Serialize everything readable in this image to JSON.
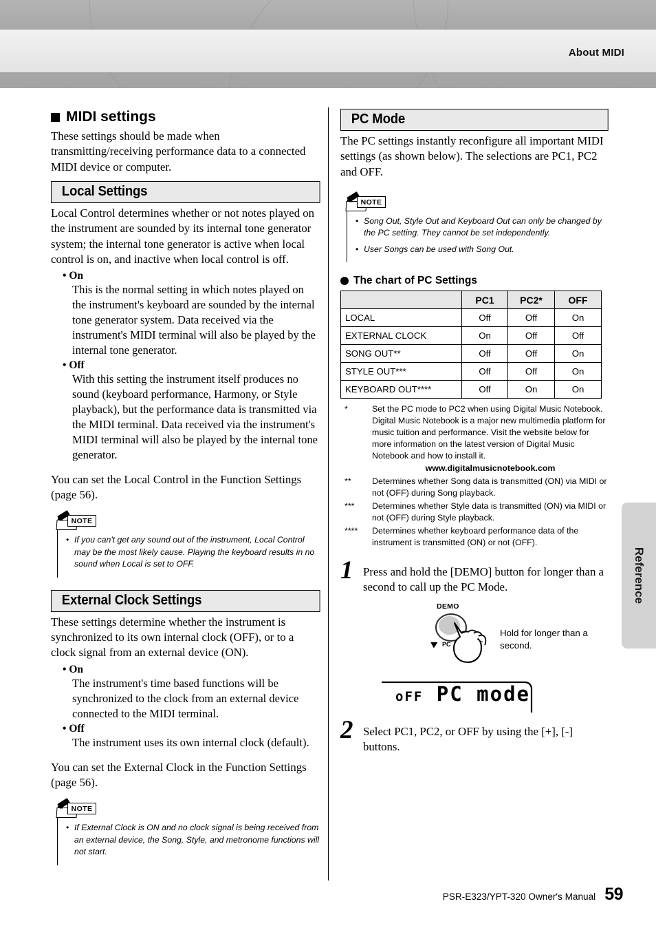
{
  "header": {
    "title": "About MIDI"
  },
  "side_tab": {
    "label": "Reference"
  },
  "footer": {
    "manual": "PSR-E323/YPT-320   Owner's Manual",
    "page": "59"
  },
  "left_column": {
    "heading": "MIDI settings",
    "intro": "These settings should be made when transmitting/receiving performance data to a connected MIDI device or computer.",
    "local": {
      "bar_title": "Local Settings",
      "intro": "Local Control determines whether or not notes played on the instrument are sounded by its internal tone generator system; the internal tone generator is active when local control is on, and inactive when local control is off.",
      "on_label": "On",
      "on_text": "This is the normal setting in which notes played on the instrument's keyboard are sounded by the internal tone generator system. Data received via the instrument's MIDI terminal will also be played by the internal tone generator.",
      "off_label": "Off",
      "off_text": "With this setting the instrument itself produces no sound (keyboard performance, Harmony, or Style playback), but the performance data is transmitted via the MIDI terminal. Data received via the instrument's MIDI terminal will also be played by the internal tone generator.",
      "closing": "You can set the Local Control in the Function Settings (page 56).",
      "note_badge": "NOTE",
      "note_text": "If you can't get any sound out of the instrument, Local Control may be the most likely cause. Playing the keyboard results in no sound when Local is set to OFF."
    },
    "external_clock": {
      "bar_title": "External Clock Settings",
      "intro": "These settings determine whether the instrument is synchronized to its own internal clock (OFF), or to a clock signal from an external device (ON).",
      "on_label": "On",
      "on_text": "The instrument's time based functions will be synchronized to the clock from an external device connected to the MIDI terminal.",
      "off_label": "Off",
      "off_text": "The instrument uses its own internal clock (default).",
      "closing": "You can set the External Clock in the Function Settings (page 56).",
      "note_badge": "NOTE",
      "note_text": "If External Clock is ON and no clock signal is being received from an external device, the Song, Style, and metronome functions will not start."
    }
  },
  "right_column": {
    "pc_mode": {
      "bar_title": "PC Mode",
      "intro": "The PC settings instantly reconfigure all important MIDI settings (as shown below). The selections are PC1, PC2 and OFF.",
      "note_badge": "NOTE",
      "note_item_1": "Song Out, Style Out and Keyboard Out can only be changed by the PC setting. They cannot be set independently.",
      "note_item_2": "User Songs can be used with Song Out."
    },
    "chart": {
      "title": "The chart of PC Settings",
      "columns": [
        "",
        "PC1",
        "PC2*",
        "OFF"
      ],
      "rows": [
        {
          "label": "LOCAL",
          "values": [
            "Off",
            "Off",
            "On"
          ]
        },
        {
          "label": "EXTERNAL CLOCK",
          "values": [
            "On",
            "Off",
            "Off"
          ]
        },
        {
          "label": "SONG OUT**",
          "values": [
            "Off",
            "Off",
            "On"
          ]
        },
        {
          "label": "STYLE OUT***",
          "values": [
            "Off",
            "Off",
            "On"
          ]
        },
        {
          "label": "KEYBOARD OUT****",
          "values": [
            "Off",
            "On",
            "On"
          ]
        }
      ]
    },
    "footnotes": [
      {
        "mark": "*",
        "text": "Set the PC mode to PC2 when using Digital Music Notebook. Digital Music Notebook is a major new multimedia platform for music tuition and performance. Visit the website below for more information on the latest version of Digital Music Notebook and how to install it.",
        "url": "www.digitalmusicnotebook.com"
      },
      {
        "mark": "**",
        "text": "Determines whether Song data is transmitted (ON) via MIDI or not (OFF) during Song playback.",
        "url": ""
      },
      {
        "mark": "***",
        "text": "Determines whether Style data is transmitted (ON) via MIDI or not (OFF) during Style playback.",
        "url": ""
      },
      {
        "mark": "****",
        "text": "Determines whether keyboard performance data of the instrument is transmitted (ON) or not (OFF).",
        "url": ""
      }
    ],
    "steps": [
      {
        "number": "1",
        "text": "Press and hold the [DEMO] button for longer than a second to call up the PC Mode."
      },
      {
        "number": "2",
        "text": "Select PC1, PC2, or OFF by using the [+], [-] buttons."
      }
    ],
    "illustration": {
      "demo_label": "DEMO",
      "pc_label": "PC",
      "hold_text": "Hold for longer than a second."
    },
    "lcd": {
      "prefix": "oFF",
      "main": "PC mode"
    }
  },
  "colors": {
    "header_gray": "#a9a9a9",
    "header_light": "#ececec",
    "section_bar_bg": "#e9e9e9",
    "table_header_bg": "#e6e6e6",
    "side_tab_bg": "#d2d2d2"
  }
}
